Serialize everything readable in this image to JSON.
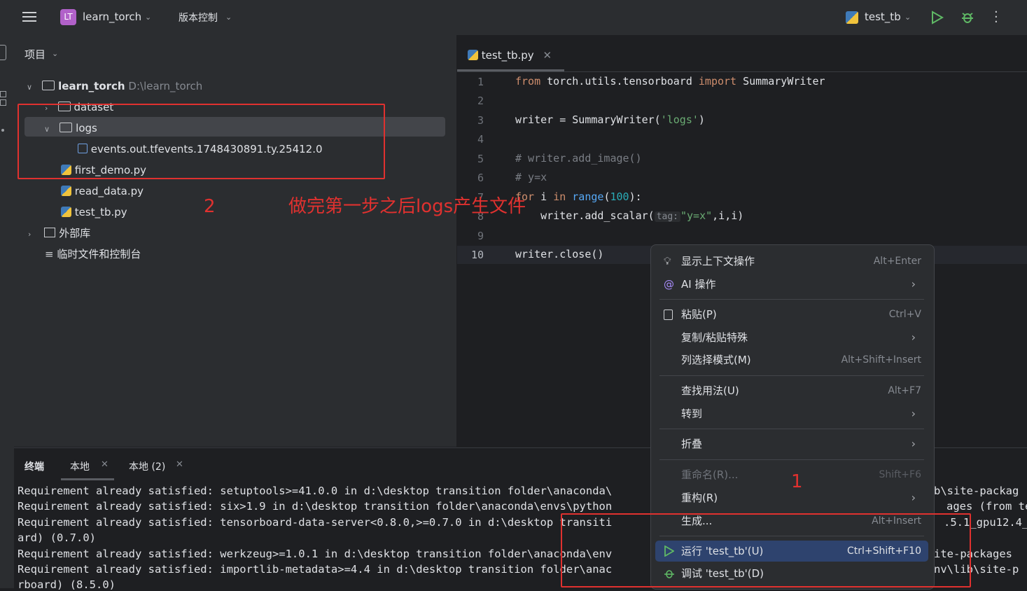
{
  "titlebar": {
    "project_badge": "LT",
    "project_name": "learn_torch",
    "vcs_label": "版本控制",
    "run_config": "test_tb",
    "icons": [
      "menu-icon",
      "chevron-down-icon",
      "python-icon",
      "run-icon",
      "debug-icon",
      "more-icon"
    ]
  },
  "project_panel": {
    "header": "项目",
    "root_name": "learn_torch",
    "root_path": "D:\\learn_torch",
    "items": [
      {
        "label": "dataset",
        "type": "folder"
      },
      {
        "label": "logs",
        "type": "folder"
      },
      {
        "label": "events.out.tfevents.1748430891.ty.25412.0",
        "type": "file"
      },
      {
        "label": "first_demo.py",
        "type": "python"
      },
      {
        "label": "read_data.py",
        "type": "python"
      },
      {
        "label": "test_tb.py",
        "type": "python"
      },
      {
        "label": "外部库",
        "type": "library"
      },
      {
        "label": "临时文件和控制台",
        "type": "scratch"
      }
    ]
  },
  "editor": {
    "tab_label": "test_tb.py",
    "line_numbers": [
      "1",
      "2",
      "3",
      "4",
      "5",
      "6",
      "7",
      "8",
      "9",
      "10"
    ],
    "code": {
      "l1_kw1": "from",
      "l1_mod": " torch.utils.tensorboard ",
      "l1_kw2": "import",
      "l1_cls": " SummaryWriter",
      "l3_a": "writer = SummaryWriter(",
      "l3_str": "'logs'",
      "l3_b": ")",
      "l5": "# writer.add_image()",
      "l6": "# y=x",
      "l7_kw": "for",
      "l7_a": " i ",
      "l7_in": "in",
      "l7_b": " ",
      "l7_fn": "range",
      "l7_c": "(",
      "l7_num": "100",
      "l7_d": "):",
      "l8_a": "    writer.add_scalar(",
      "l8_hint": "tag:",
      "l8_str": "\"y=x\"",
      "l8_b": ",i,i)",
      "l10": "writer.close()"
    }
  },
  "context_menu": {
    "items": [
      {
        "label": "显示上下文操作",
        "shortcut": "Alt+Enter"
      },
      {
        "label": "AI 操作",
        "shortcut": ""
      },
      {
        "label": "粘贴(P)",
        "shortcut": "Ctrl+V"
      },
      {
        "label": "复制/粘贴特殊",
        "shortcut": ""
      },
      {
        "label": "列选择模式(M)",
        "shortcut": "Alt+Shift+Insert"
      },
      {
        "label": "查找用法(U)",
        "shortcut": "Alt+F7"
      },
      {
        "label": "转到",
        "shortcut": ""
      },
      {
        "label": "折叠",
        "shortcut": ""
      },
      {
        "label": "重命名(R)...",
        "shortcut": "Shift+F6"
      },
      {
        "label": "重构(R)",
        "shortcut": ""
      },
      {
        "label": "生成...",
        "shortcut": "Alt+Insert"
      },
      {
        "label": "运行 'test_tb'(U)",
        "shortcut": "Ctrl+Shift+F10"
      },
      {
        "label": "调试 'test_tb'(D)",
        "shortcut": ""
      }
    ]
  },
  "terminal": {
    "tabs": [
      "终端",
      "本地",
      "本地 (2)"
    ],
    "lines": [
      "Requirement already satisfied: setuptools>=41.0.0 in d:\\desktop transition folder\\anaconda\\",
      "Requirement already satisfied: six>1.9 in d:\\desktop transition folder\\anaconda\\envs\\python",
      "Requirement already satisfied: tensorboard-data-server<0.8.0,>=0.7.0 in d:\\desktop transiti",
      "ard) (0.7.0)",
      "Requirement already satisfied: werkzeug>=1.0.1 in d:\\desktop transition folder\\anaconda\\env",
      "Requirement already satisfied: importlib-metadata>=4.4 in d:\\desktop transition folder\\anac",
      "rboard) (8.5.0)"
    ],
    "right_fragments": [
      "b\\site-packag",
      "ages (from te",
      ".5.1_gpu12.4_",
      "",
      "ite-packages",
      "nv\\lib\\site-p"
    ]
  },
  "annotations": {
    "label_1": "1",
    "label_2": "2",
    "note": "做完第一步之后logs产生文件",
    "color": "#e0312f"
  },
  "colors": {
    "accent": "#2e436e",
    "keyword": "#cf8e6d",
    "string": "#6aab73",
    "number": "#2aacb8",
    "run_green": "#5fb865"
  }
}
